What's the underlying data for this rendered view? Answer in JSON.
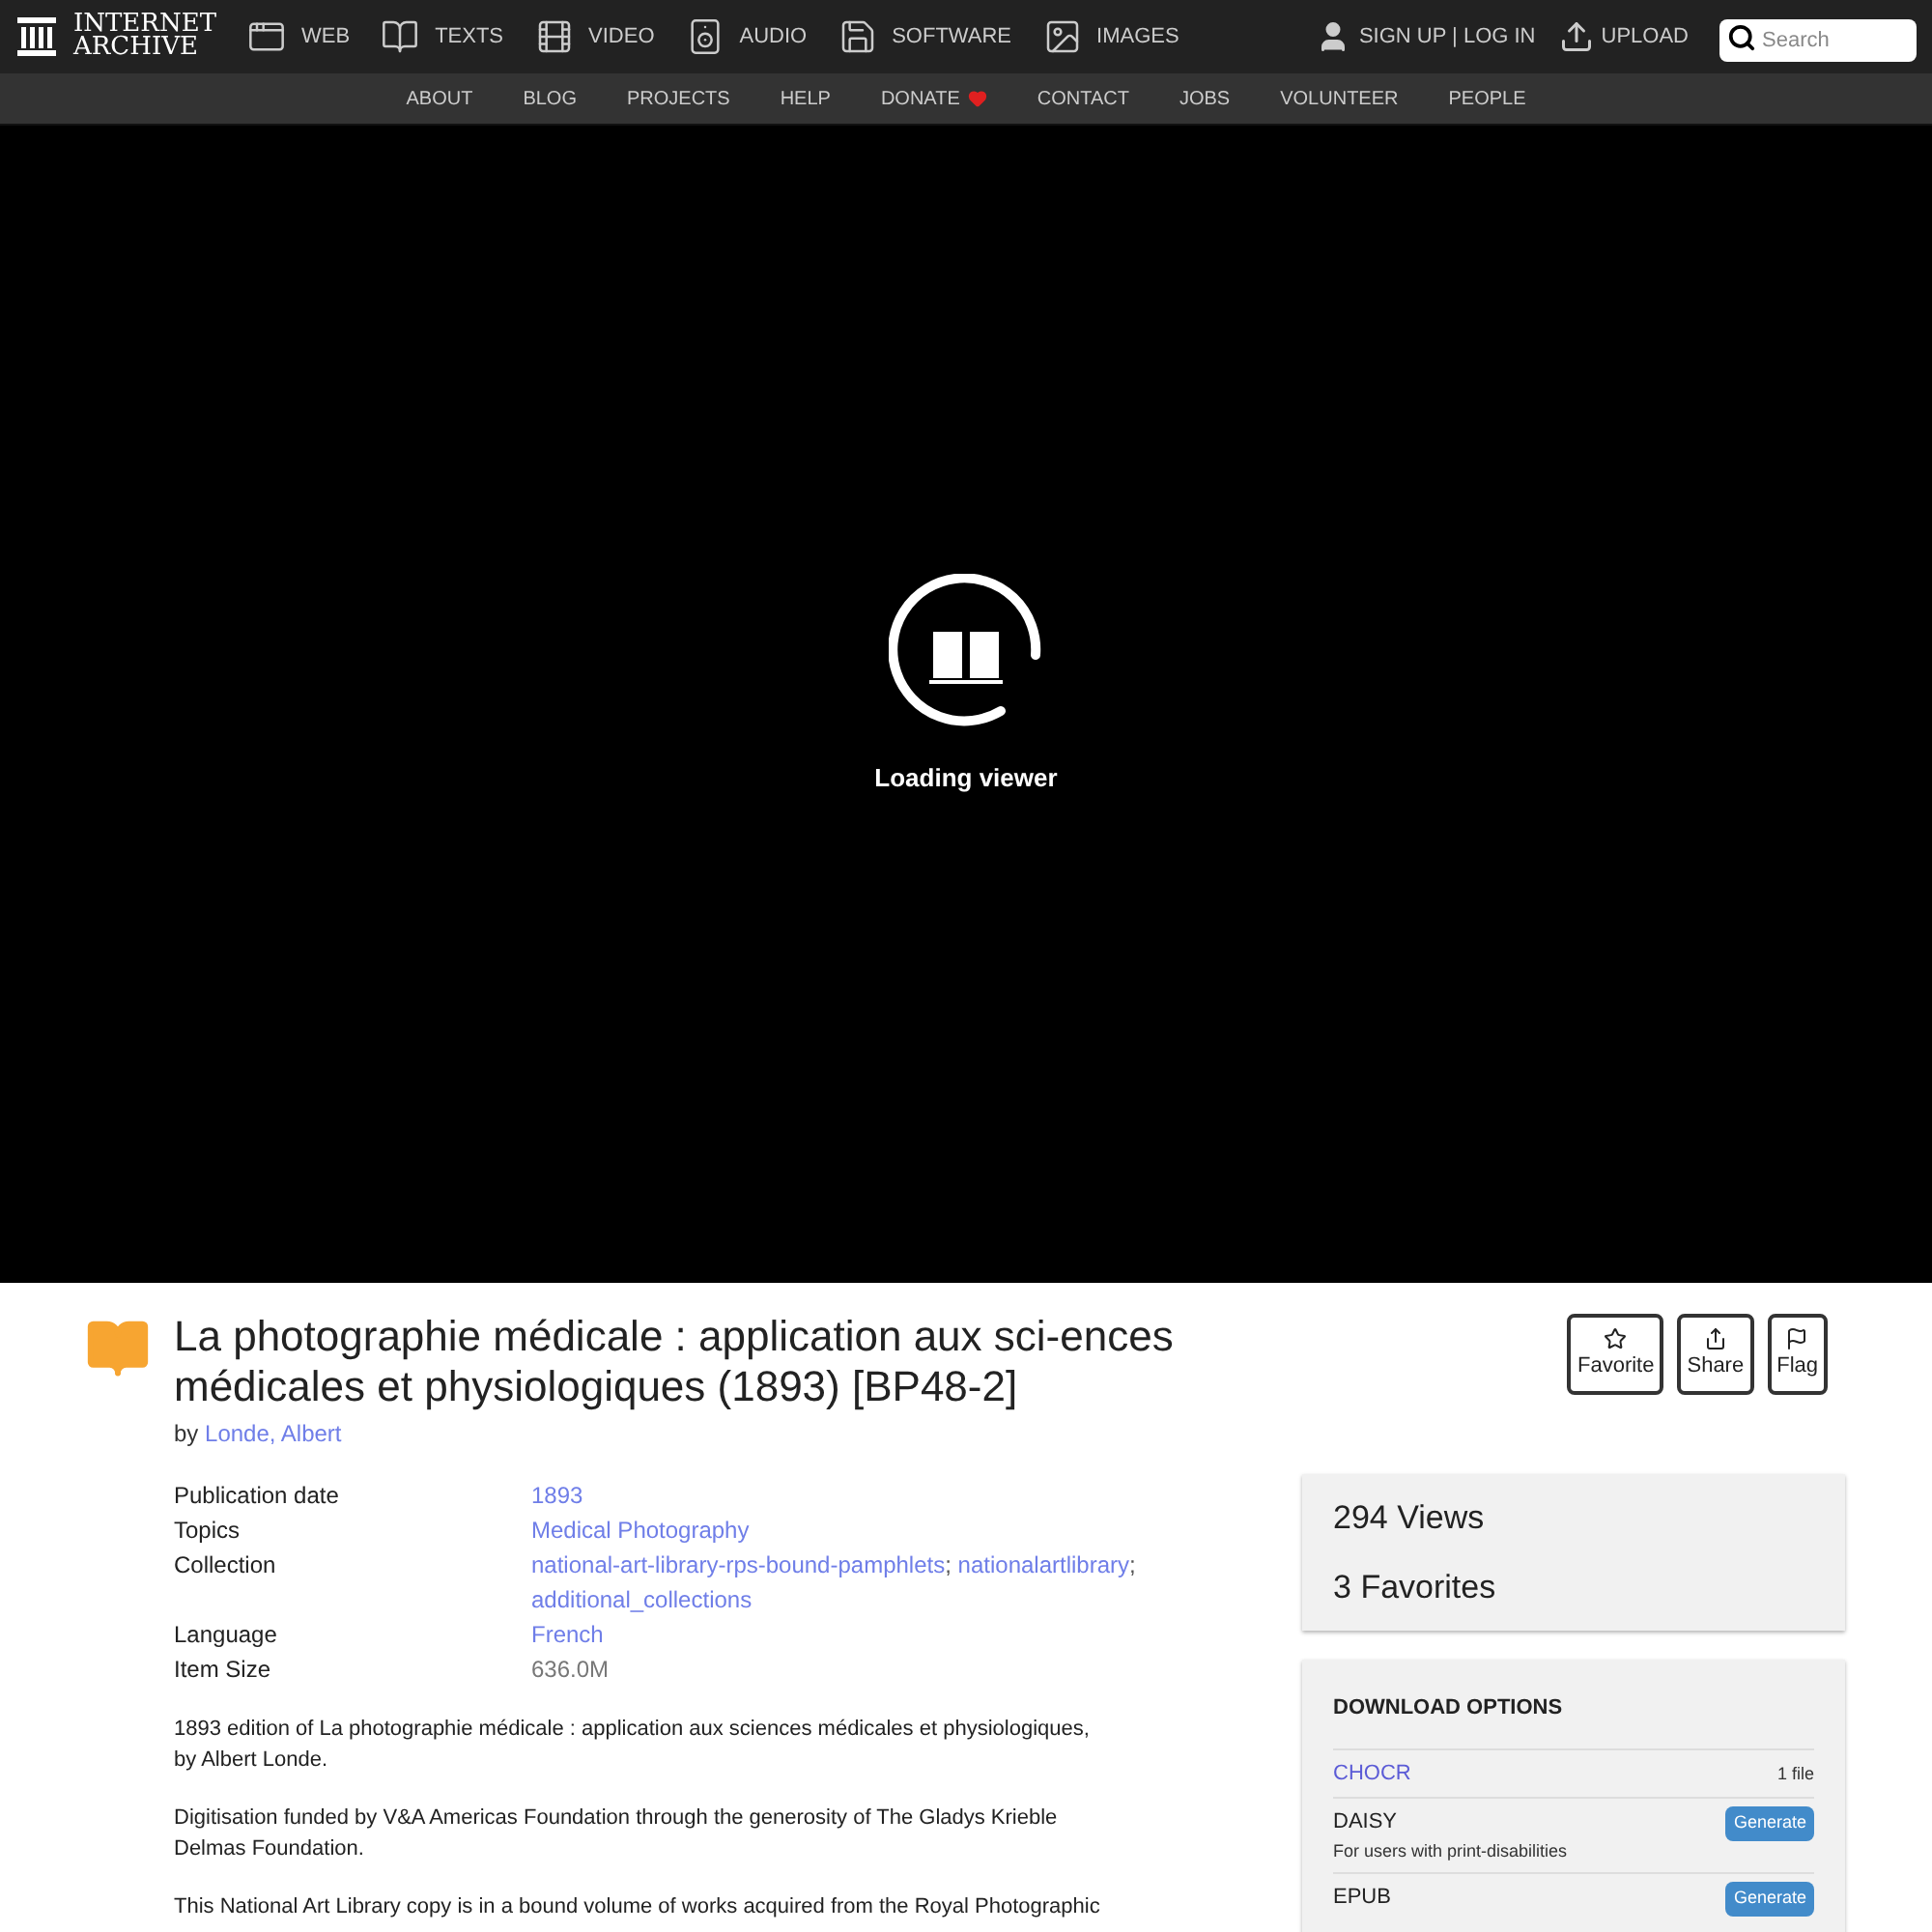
{
  "logo": {
    "line1": "INTERNET",
    "line2": "ARCHIVE"
  },
  "media_nav": [
    {
      "label": "WEB",
      "kind": "web"
    },
    {
      "label": "TEXTS",
      "kind": "texts"
    },
    {
      "label": "VIDEO",
      "kind": "video"
    },
    {
      "label": "AUDIO",
      "kind": "audio"
    },
    {
      "label": "SOFTWARE",
      "kind": "software"
    },
    {
      "label": "IMAGES",
      "kind": "images"
    }
  ],
  "account": {
    "label": "SIGN UP | LOG IN"
  },
  "upload": {
    "label": "UPLOAD"
  },
  "search": {
    "placeholder": "Search"
  },
  "sub_nav": [
    {
      "label": "ABOUT",
      "heart": false
    },
    {
      "label": "BLOG",
      "heart": false
    },
    {
      "label": "PROJECTS",
      "heart": false
    },
    {
      "label": "HELP",
      "heart": false
    },
    {
      "label": "DONATE",
      "heart": true
    },
    {
      "label": "CONTACT",
      "heart": false
    },
    {
      "label": "JOBS",
      "heart": false
    },
    {
      "label": "VOLUNTEER",
      "heart": false
    },
    {
      "label": "PEOPLE",
      "heart": false
    }
  ],
  "viewer": {
    "status": "Loading viewer"
  },
  "item": {
    "title": "La photographie médicale : application aux sci-ences médicales et physiologiques (1893) [BP48-2]",
    "by": "by",
    "author": "Londe, Albert"
  },
  "actions": [
    {
      "label": "Favorite",
      "kind": "star"
    },
    {
      "label": "Share",
      "kind": "share"
    },
    {
      "label": "Flag",
      "kind": "flag"
    }
  ],
  "metadata": [
    {
      "label": "Publication date",
      "values": [
        {
          "text": "1893",
          "kind": "link"
        }
      ]
    },
    {
      "label": "Topics",
      "values": [
        {
          "text": "Medical Photography",
          "kind": "link"
        }
      ]
    },
    {
      "label": "Collection",
      "values": [
        {
          "text": "national-art-library-rps-bound-pamphlets",
          "kind": "link",
          "separator": ";"
        },
        {
          "text": "nationalartlibrary",
          "kind": "link",
          "separator": ";"
        },
        {
          "text": "additional_collections",
          "kind": "link"
        }
      ]
    },
    {
      "label": "Language",
      "values": [
        {
          "text": "French",
          "kind": "link"
        }
      ]
    },
    {
      "label": "Item Size",
      "values": [
        {
          "text": "636.0M",
          "kind": "plain"
        }
      ]
    }
  ],
  "description": [
    "1893 edition of La photographie médicale : application aux sciences médicales et physiologiques, by Albert Londe.",
    "Digitisation funded by V&A Americas Foundation through the generosity of The Gladys Krieble Delmas Foundation.",
    "This National Art Library copy is in a bound volume of works acquired from the Royal Photographic"
  ],
  "stats": [
    {
      "count": "294",
      "label": "Views"
    },
    {
      "count": "3",
      "label": "Favorites"
    }
  ],
  "downloads": {
    "title": "DOWNLOAD OPTIONS",
    "rows": [
      {
        "label": "CHOCR",
        "kind": "link",
        "action": {
          "kind": "count",
          "text": "1 file"
        }
      },
      {
        "label": "DAISY",
        "kind": "plain",
        "note": "For users with print-disabilities",
        "action": {
          "kind": "button",
          "text": "Generate"
        }
      },
      {
        "label": "EPUB",
        "kind": "plain",
        "action": {
          "kind": "button",
          "text": "Generate"
        }
      }
    ]
  }
}
